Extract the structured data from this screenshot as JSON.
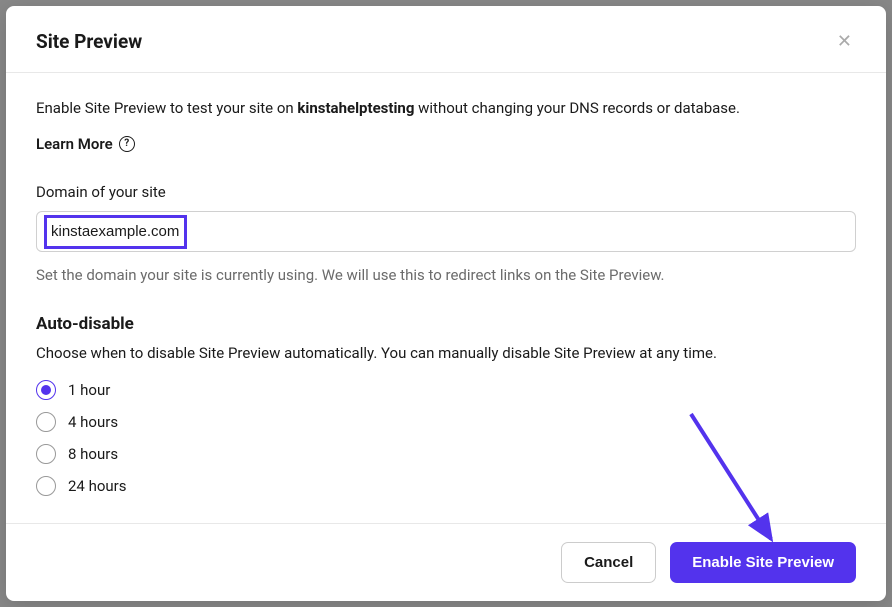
{
  "modal": {
    "title": "Site Preview",
    "description_prefix": "Enable Site Preview to test your site on ",
    "description_bold": "kinstahelptesting",
    "description_suffix": " without changing your DNS records or database.",
    "learn_more": "Learn More",
    "domain_label": "Domain of your site",
    "domain_value": "kinstaexample.com",
    "domain_helper": "Set the domain your site is currently using. We will use this to redirect links on the Site Preview.",
    "auto_disable_heading": "Auto-disable",
    "auto_disable_desc": "Choose when to disable Site Preview automatically. You can manually disable Site Preview at any time.",
    "radio_options": [
      {
        "label": "1 hour",
        "selected": true
      },
      {
        "label": "4 hours",
        "selected": false
      },
      {
        "label": "8 hours",
        "selected": false
      },
      {
        "label": "24 hours",
        "selected": false
      }
    ],
    "cancel_label": "Cancel",
    "submit_label": "Enable Site Preview"
  },
  "colors": {
    "accent": "#5333ed"
  }
}
